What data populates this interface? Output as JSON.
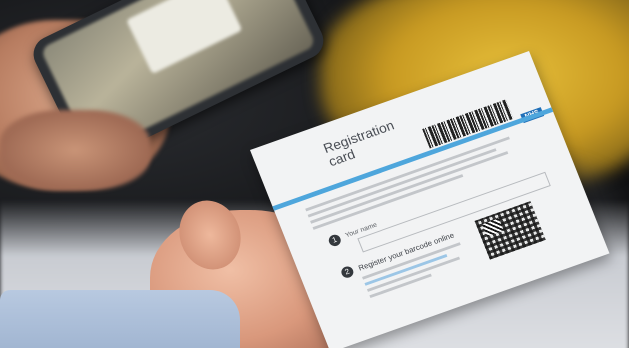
{
  "card": {
    "title_line1": "Registration",
    "title_line2": "card",
    "step1_number": "1",
    "step1_label": "Your name",
    "step2_number": "2",
    "step2_label": "Register your barcode online",
    "logo_text": "NHS"
  },
  "colors": {
    "accent_stripe": "#4ea6dc",
    "logo_blue": "#1f6fb8",
    "background_yellow": "#e6bf3a"
  }
}
